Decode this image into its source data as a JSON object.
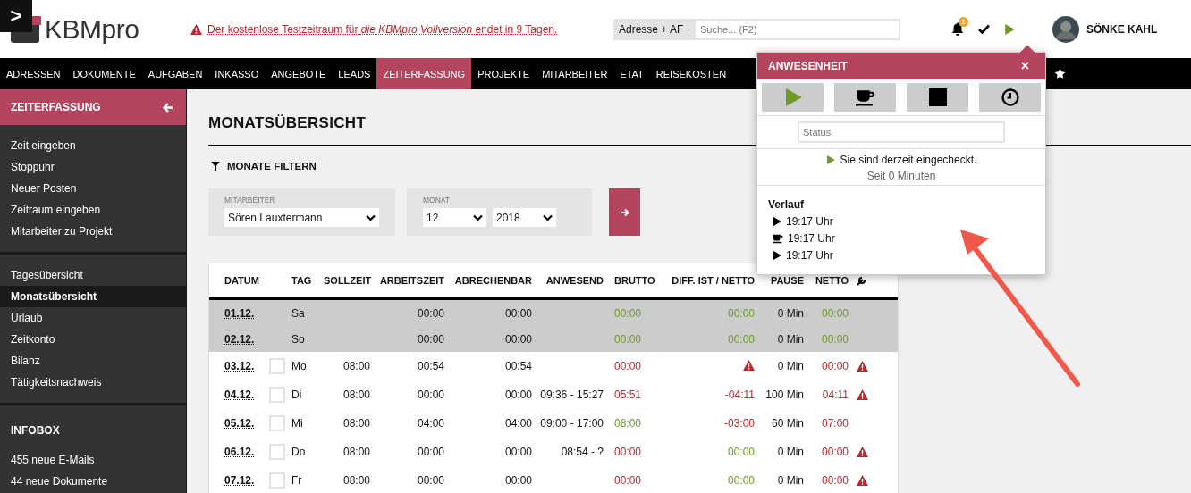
{
  "topbar": {
    "toggle": ">",
    "logo": "KBMpro",
    "notice": "Der kostenlose Testzeitraum für *die KBMpro Vollversion* endet in 9 Tagen.",
    "search_scope": "Adresse + AF",
    "search": {
      "placeholder": "Suche... (F2)"
    },
    "notification_count": "1",
    "user": "SÖNKE KAHL"
  },
  "nav": [
    {
      "label": "ADRESSEN",
      "selected": false
    },
    {
      "label": "DOKUMENTE",
      "selected": false
    },
    {
      "label": "AUFGABEN",
      "selected": false
    },
    {
      "label": "INKASSO",
      "selected": false
    },
    {
      "label": "ANGEBOTE",
      "selected": false
    },
    {
      "label": "LEADS",
      "selected": false
    },
    {
      "label": "ZEITERFASSUNG",
      "selected": true
    },
    {
      "label": "PROJEKTE",
      "selected": false
    },
    {
      "label": "MITARBEITER",
      "selected": false
    },
    {
      "label": "ETAT",
      "selected": false
    },
    {
      "label": "REISEKOSTEN",
      "selected": false
    }
  ],
  "sidebar": {
    "title": "ZEITERFASSUNG",
    "groups": [
      {
        "items": [
          {
            "label": "Zeit eingeben",
            "selected": false
          },
          {
            "label": "Stoppuhr",
            "selected": false
          },
          {
            "label": "Neuer Posten",
            "selected": false
          },
          {
            "label": "Zeitraum eingeben",
            "selected": false
          },
          {
            "label": "Mitarbeiter zu Projekt",
            "selected": false
          }
        ]
      },
      {
        "items": [
          {
            "label": "Tagesübersicht",
            "selected": false
          },
          {
            "label": "Monatsübersicht",
            "selected": true
          },
          {
            "label": "Urlaub",
            "selected": false
          },
          {
            "label": "Zeitkonto",
            "selected": false
          },
          {
            "label": "Bilanz",
            "selected": false
          },
          {
            "label": "Tätigkeitsnachweis",
            "selected": false
          }
        ]
      },
      {
        "title": "INFOBOX",
        "items": [
          {
            "label": "455 neue E-Mails",
            "selected": false
          },
          {
            "label": "44 neue Dokumente",
            "selected": false
          }
        ]
      }
    ]
  },
  "page_title": "MONATSÜBERSICHT",
  "filter": {
    "title": "MONATE FILTERN",
    "employee_label": "MITARBEITER",
    "employee": "Sören Lauxtermann",
    "month_label": "MONAT",
    "month": "12",
    "year": "2018"
  },
  "table": {
    "columns": [
      "DATUM",
      "TAG",
      "SOLLZEIT",
      "ARBEITSZEIT",
      "ABRECHENBAR",
      "ANWESEND",
      "BRUTTO",
      "DIFF. IST / NETTO",
      "PAUSE",
      "NETTO"
    ],
    "rows": [
      {
        "kind": "weekend",
        "date": "01.12.",
        "day": "Sa",
        "worked": "00:00",
        "billable": "00:00",
        "gross": {
          "text": "00:00",
          "positive": true
        },
        "diff": {
          "text": "00:00",
          "positive": true
        },
        "pause": "0 Min",
        "net": {
          "text": "00:00",
          "positive": true
        },
        "warning": false
      },
      {
        "kind": "weekend",
        "date": "02.12.",
        "day": "So",
        "worked": "00:00",
        "billable": "00:00",
        "gross": {
          "text": "00:00",
          "positive": true
        },
        "diff": {
          "text": "00:00",
          "positive": true
        },
        "pause": "0 Min",
        "net": {
          "text": "00:00",
          "positive": true
        },
        "warning": false
      },
      {
        "kind": "workday",
        "checked": false,
        "date": "03.12.",
        "day": "Mo",
        "target": "08:00",
        "worked": "00:54",
        "billable": "00:54",
        "gross": {
          "text": "00:00",
          "positive": false
        },
        "diff_warning": true,
        "pause": "0 Min",
        "net": {
          "text": "00:00",
          "positive": false
        },
        "warning": true
      },
      {
        "kind": "workday",
        "checked": false,
        "date": "04.12.",
        "day": "Di",
        "target": "08:00",
        "worked": "00:00",
        "billable": "00:00",
        "present": "09:36 - 15:27",
        "gross": {
          "text": "05:51",
          "positive": false
        },
        "diff": {
          "text": "-04:11",
          "positive": false
        },
        "pause": "100 Min",
        "net": {
          "text": "04:11",
          "positive": false
        },
        "warning": true
      },
      {
        "kind": "workday",
        "checked": false,
        "date": "05.12.",
        "day": "Mi",
        "target": "08:00",
        "worked": "04:00",
        "billable": "04:00",
        "present": "09:00 - 17:00",
        "gross": {
          "text": "08:00",
          "positive": true
        },
        "diff": {
          "text": "-03:00",
          "positive": false
        },
        "pause": "60 Min",
        "net": {
          "text": "07:00",
          "positive": false
        },
        "warning": false
      },
      {
        "kind": "workday",
        "checked": false,
        "date": "06.12.",
        "day": "Do",
        "target": "08:00",
        "worked": "00:00",
        "billable": "00:00",
        "present": "08:54 - ?",
        "gross": {
          "text": "00:00",
          "positive": false
        },
        "diff": {
          "text": "00:00",
          "positive": true
        },
        "pause": "0 Min",
        "net": {
          "text": "00:00",
          "positive": false
        },
        "warning": true
      },
      {
        "kind": "workday",
        "checked": false,
        "date": "07.12.",
        "day": "Fr",
        "target": "08:00",
        "worked": "00:00",
        "billable": "00:00",
        "gross": {
          "text": "00:00",
          "positive": false
        },
        "diff": {
          "text": "00:00",
          "positive": true
        },
        "pause": "0 Min",
        "net": {
          "text": "00:00",
          "positive": false
        },
        "warning": true
      }
    ]
  },
  "popup": {
    "title": "ANWESENHEIT",
    "close": "×",
    "status": {
      "placeholder": "Status"
    },
    "message": "Sie sind derzeit eingecheckt.",
    "since": "Seit 0 Minuten",
    "history_title": "Verlauf",
    "history": [
      {
        "kind": "start",
        "time": "19:17 Uhr"
      },
      {
        "kind": "break",
        "time": "19:17 Uhr"
      },
      {
        "kind": "start",
        "time": "19:17 Uhr"
      }
    ]
  }
}
